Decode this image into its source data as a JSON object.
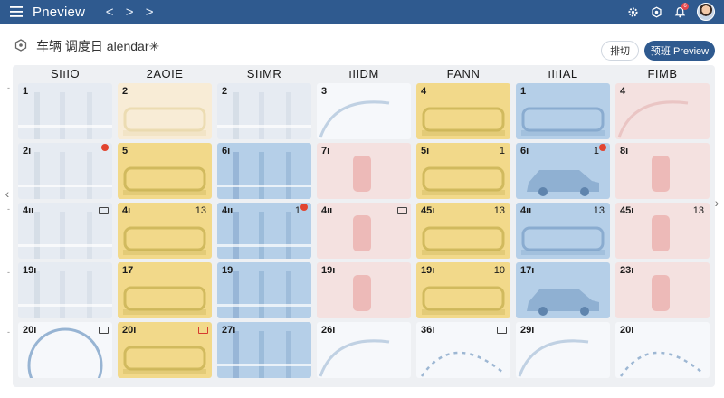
{
  "app": {
    "title": "Pneview"
  },
  "topbar": {
    "nav_back": "<",
    "nav_forward_1": ">",
    "nav_forward_2": ">",
    "notification_count": "6",
    "icons": [
      "menu-icon",
      "gear-icon",
      "settings-icon",
      "bell-icon",
      "avatar"
    ]
  },
  "header": {
    "title": "车辆 调度日 alendar✳",
    "sort_button": "排切",
    "preview_button": "预班 Preview"
  },
  "weekdays": [
    "SIıIO",
    "2AOIE",
    "SIıMR",
    "ıIIDM",
    "FANN",
    "ıIıIAL",
    "FIMB"
  ],
  "rows": [
    [
      {
        "num": "1",
        "color": "gray",
        "art": "bars",
        "cnt": ""
      },
      {
        "num": "2",
        "color": "cream",
        "art": "bus",
        "cnt": ""
      },
      {
        "num": "2",
        "color": "gray",
        "art": "bars",
        "cnt": ""
      },
      {
        "num": "3",
        "color": "white",
        "art": "arc",
        "cnt": ""
      },
      {
        "num": "4",
        "color": "yellow",
        "art": "bus",
        "cnt": ""
      },
      {
        "num": "1",
        "color": "blue",
        "art": "bus",
        "cnt": ""
      },
      {
        "num": "4",
        "color": "pink",
        "art": "arc",
        "cnt": ""
      }
    ],
    [
      {
        "num": "2ı",
        "color": "gray",
        "art": "bars",
        "cnt": "",
        "pin": true
      },
      {
        "num": "5",
        "color": "yellow",
        "art": "bus",
        "cnt": ""
      },
      {
        "num": "6ı",
        "color": "blue",
        "art": "bars",
        "cnt": ""
      },
      {
        "num": "7ı",
        "color": "pink",
        "art": "pillar",
        "cnt": ""
      },
      {
        "num": "5ı",
        "color": "yellow",
        "art": "bus",
        "cnt": "1"
      },
      {
        "num": "6ı",
        "color": "blue",
        "art": "car",
        "cnt": "1",
        "pin": true
      },
      {
        "num": "8ı",
        "color": "pink",
        "art": "pillar",
        "cnt": ""
      }
    ],
    [
      {
        "num": "4ıı",
        "color": "gray",
        "art": "bars",
        "cnt": "",
        "note": true
      },
      {
        "num": "4ı",
        "color": "yellow",
        "art": "bus",
        "cnt": "13"
      },
      {
        "num": "4ıı",
        "color": "blue",
        "art": "bars",
        "cnt": "1",
        "pin": true
      },
      {
        "num": "4ıı",
        "color": "pink",
        "art": "pillar",
        "cnt": "",
        "note": true
      },
      {
        "num": "45ı",
        "color": "yellow",
        "art": "bus",
        "cnt": "13"
      },
      {
        "num": "4ıı",
        "color": "blue",
        "art": "bus",
        "cnt": "13"
      },
      {
        "num": "45ı",
        "color": "pink",
        "art": "pillar",
        "cnt": "13"
      }
    ],
    [
      {
        "num": "19ı",
        "color": "gray",
        "art": "bars",
        "cnt": ""
      },
      {
        "num": "17",
        "color": "yellow",
        "art": "bus",
        "cnt": ""
      },
      {
        "num": "19",
        "color": "blue",
        "art": "bars",
        "cnt": ""
      },
      {
        "num": "19ı",
        "color": "pink",
        "art": "pillar",
        "cnt": ""
      },
      {
        "num": "19ı",
        "color": "yellow",
        "art": "bus",
        "cnt": "10"
      },
      {
        "num": "17ı",
        "color": "blue",
        "art": "car",
        "cnt": ""
      },
      {
        "num": "23ı",
        "color": "pink",
        "art": "pillar",
        "cnt": ""
      }
    ],
    [
      {
        "num": "20ı",
        "color": "white",
        "art": "circle",
        "cnt": "",
        "note": true
      },
      {
        "num": "20ı",
        "color": "yellow",
        "art": "bus",
        "cnt": "",
        "note": true,
        "note_red": true
      },
      {
        "num": "27ı",
        "color": "blue",
        "art": "bars",
        "cnt": ""
      },
      {
        "num": "26ı",
        "color": "white",
        "art": "arc",
        "cnt": ""
      },
      {
        "num": "36ı",
        "color": "white",
        "art": "dotted",
        "cnt": "",
        "note": true
      },
      {
        "num": "29ı",
        "color": "white",
        "art": "arc",
        "cnt": ""
      },
      {
        "num": "20ı",
        "color": "white",
        "art": "dotted",
        "cnt": ""
      }
    ]
  ]
}
